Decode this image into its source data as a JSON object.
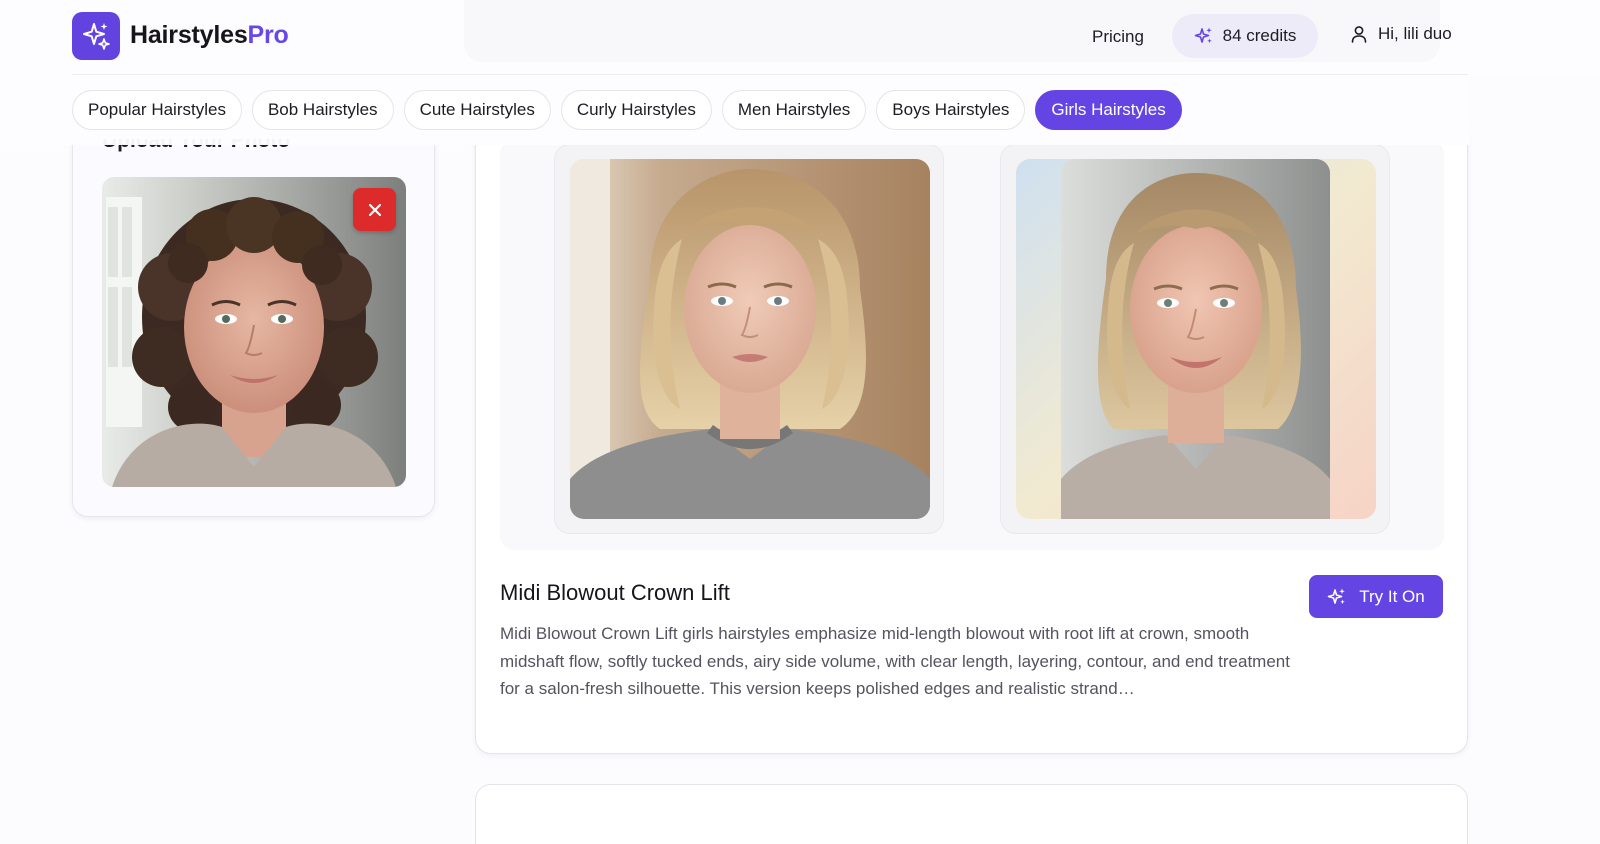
{
  "header": {
    "brand_main": "Hairstyles",
    "brand_accent": "Pro",
    "logo_icon": "sparkles-icon",
    "pricing_label": "Pricing",
    "credits_label": "84 credits",
    "credits_icon": "sparkles-icon",
    "user_greeting": "Hi, lili duo",
    "user_icon": "user-icon"
  },
  "categories": {
    "active_index": 6,
    "items": [
      "Popular Hairstyles",
      "Bob Hairstyles",
      "Cute Hairstyles",
      "Curly Hairstyles",
      "Men Hairstyles",
      "Boys Hairstyles",
      "Girls Hairstyles"
    ]
  },
  "upload": {
    "title": "Upload Your Photo",
    "remove_icon": "close-icon"
  },
  "result": {
    "title": "Midi Blowout Crown Lift",
    "try_label": "Try It On",
    "try_icon": "sparkles-icon",
    "description": "Midi Blowout Crown Lift girls hairstyles emphasize mid-length blowout with root lift at crown, smooth midshaft flow, softly tucked ends, airy side volume, with clear length, layering, contour, and end treatment for a salon-fresh silhouette. This version keeps polished edges and realistic strand…"
  },
  "colors": {
    "brand": "#6445e3",
    "danger": "#dd2a2a",
    "credits_bg": "#ecebf7"
  }
}
